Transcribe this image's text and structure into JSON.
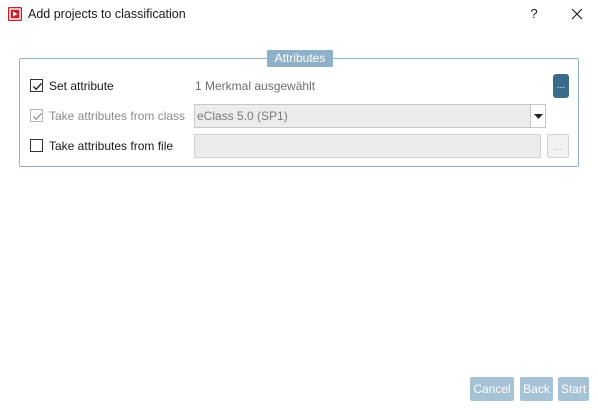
{
  "window": {
    "title": "Add projects to classification",
    "help_label": "?"
  },
  "group": {
    "legend": "Attributes"
  },
  "rows": {
    "set_attribute": {
      "label": "Set attribute",
      "checked": true,
      "value": "1 Merkmal ausgewählt",
      "button_label": "..."
    },
    "from_class": {
      "label": "Take attributes from class",
      "checked": true,
      "enabled": false,
      "selected": "eClass 5.0 (SP1)"
    },
    "from_file": {
      "label": "Take attributes from file",
      "checked": false,
      "value": "",
      "button_label": "..."
    }
  },
  "footer": {
    "cancel_label": "Cancel",
    "back_label": "Back",
    "start_label": "Start"
  },
  "colors": {
    "accent": "#3a6a8c",
    "legend_bg": "#8eb0c8",
    "disabled_button_bg": "#a6c2d6",
    "app_icon": "#c8202a"
  }
}
